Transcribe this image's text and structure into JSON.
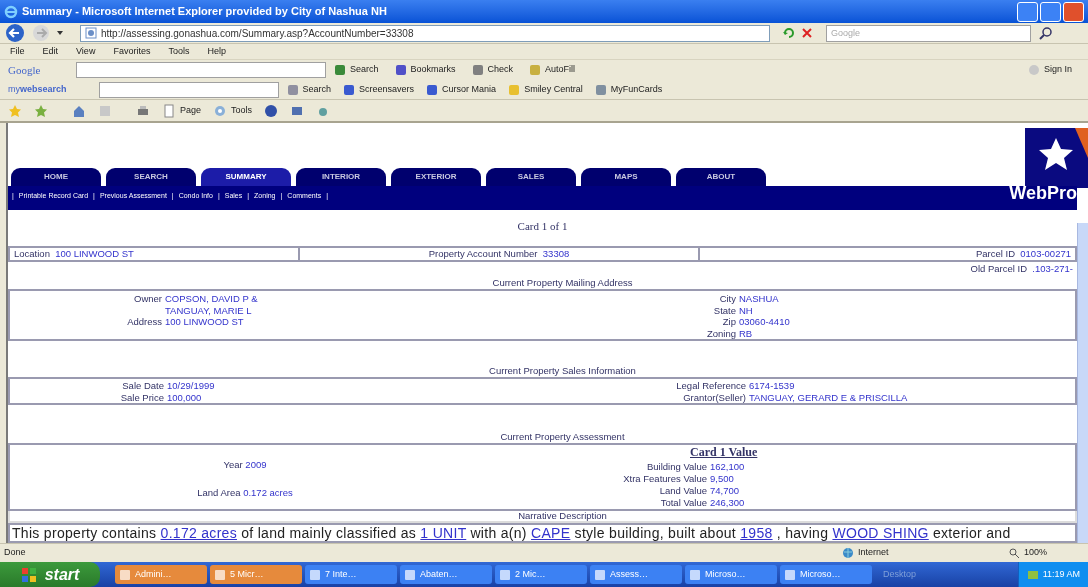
{
  "window": {
    "title": "Summary - Microsoft Internet Explorer provided by City of Nashua NH"
  },
  "address_bar": {
    "url": "http://assessing.gonashua.com/Summary.asp?AccountNumber=33308"
  },
  "search_box": {
    "placeholder": "Google"
  },
  "menu": [
    "File",
    "Edit",
    "View",
    "Favorites",
    "Tools",
    "Help"
  ],
  "google_toolbar": {
    "logo": "Google",
    "items": [
      "Search",
      "Bookmarks",
      "Check",
      "AutoFill"
    ],
    "sign_in": "Sign In"
  },
  "web_toolbar": {
    "logo": "my**websearch**",
    "items": [
      "Search",
      "Screensavers",
      "Cursor Mania",
      "Smiley Central",
      "MyFunCards"
    ]
  },
  "command_bar": [
    "Page",
    "Tools"
  ],
  "page": {
    "tabs": [
      {
        "label": "HOME",
        "selected": false
      },
      {
        "label": "SEARCH",
        "selected": false
      },
      {
        "label": "SUMMARY",
        "selected": true
      },
      {
        "label": "INTERIOR",
        "selected": false
      },
      {
        "label": "EXTERIOR",
        "selected": false
      },
      {
        "label": "SALES",
        "selected": false
      },
      {
        "label": "MAPS",
        "selected": false
      },
      {
        "label": "ABOUT",
        "selected": false
      }
    ],
    "links": {
      "separator": "|",
      "items": [
        "Printable Record Card",
        "Previous Assessment",
        "Condo Info",
        "Sales",
        "Zoning",
        "Comments"
      ]
    },
    "brand": "WebPro",
    "card": "Card 1 of 1",
    "location": {
      "label": "Location",
      "value": "100 LINWOOD ST"
    },
    "account": {
      "label": "Property Account Number",
      "value": "33308"
    },
    "parcel": {
      "label": "Parcel ID",
      "value": "0103-00271"
    },
    "old_parcel": {
      "label": "Old Parcel ID",
      "value": ".103-271-"
    },
    "mailing": {
      "heading": "Current Property Mailing Address",
      "left": [
        {
          "label": "Owner",
          "values": [
            "COPSON, DAVID P &",
            "TANGUAY, MARIE L"
          ]
        },
        {
          "label": "Address",
          "values": [
            "100 LINWOOD ST"
          ]
        }
      ],
      "right": [
        {
          "label": "City",
          "values": [
            "NASHUA"
          ]
        },
        {
          "label": "State",
          "values": [
            "NH"
          ]
        },
        {
          "label": "Zip",
          "values": [
            "03060-4410"
          ]
        },
        {
          "label": "Zoning",
          "values": [
            "RB"
          ]
        }
      ]
    },
    "sales": {
      "heading": "Current Property Sales Information",
      "left": [
        {
          "label": "Sale Date",
          "values": [
            "10/29/1999"
          ]
        },
        {
          "label": "Sale Price",
          "values": [
            "100,000"
          ]
        }
      ],
      "right": [
        {
          "label": "Legal Reference",
          "values": [
            "6174-1539"
          ]
        },
        {
          "label": "Grantor(Seller)",
          "values": [
            "TANGUAY, GERARD E & PRISCILLA"
          ]
        }
      ]
    },
    "assessment": {
      "heading": "Current Property Assessment",
      "left": [
        {
          "label": "Year",
          "values": [
            "2009"
          ]
        },
        {
          "label": "Land Area",
          "values": [
            "0.172 acres"
          ]
        }
      ],
      "value_heading": "Card 1 Value",
      "right": [
        {
          "label": "Building Value",
          "values": [
            "162,100"
          ]
        },
        {
          "label": "Xtra Features Value",
          "values": [
            "9,500"
          ]
        },
        {
          "label": "Land Value",
          "values": [
            "74,700"
          ]
        },
        {
          "label": "Total Value",
          "values": [
            "246,300"
          ]
        }
      ]
    },
    "narrative": {
      "heading": "Narrative Description",
      "segments": [
        {
          "text": "This property contains",
          "link": false
        },
        {
          "text": "0.172 acres",
          "link": true
        },
        {
          "text": "of land mainly classified as",
          "link": false
        },
        {
          "text": "1 UNIT",
          "link": true
        },
        {
          "text": "with a(n)",
          "link": false
        },
        {
          "text": "CAPE",
          "link": true
        },
        {
          "text": "style building, built about",
          "link": false
        },
        {
          "text": "1958",
          "link": true
        },
        {
          "text": ", having",
          "link": false
        },
        {
          "text": "WOOD SHING",
          "link": true
        },
        {
          "text": "exterior and",
          "link": false
        }
      ]
    }
  },
  "status_bar": {
    "text": "Done",
    "zone": "Internet",
    "zoom": "100%"
  },
  "taskbar": {
    "start": "start",
    "tasks": [
      "Admini…",
      "5 Micr…",
      "7 Inte…",
      "Abaten…",
      "2 Mic…",
      "Assess…",
      "Microso…",
      "Microso…"
    ],
    "desktop": "Desktop",
    "clock": "11:19 AM"
  }
}
